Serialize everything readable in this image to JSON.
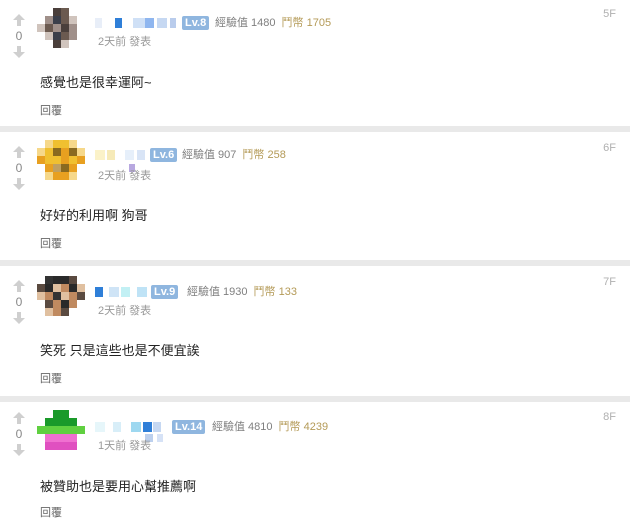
{
  "comments": [
    {
      "floor": "5F",
      "vote_count": "0",
      "level": "Lv.8",
      "exp_label": "經驗值 1480",
      "coin_label": "鬥幣 1705",
      "time": "2天前 發表",
      "text": "感覺也是很幸運阿~",
      "reply": "回覆",
      "avatar_colors": [
        "#6b5a50",
        "#a0908a",
        "#4a3f3b",
        "#d0c4bd",
        "#3b3f4a"
      ]
    },
    {
      "floor": "6F",
      "vote_count": "0",
      "level": "Lv.6",
      "exp_label": "經驗值 907",
      "coin_label": "鬥幣 258",
      "time": "2天前 發表",
      "text": "好好的利用啊 狗哥",
      "reply": "回覆",
      "avatar_colors": [
        "#f0c030",
        "#e8a020",
        "#8a6a20",
        "#f6d88a",
        "#c0a060"
      ]
    },
    {
      "floor": "7F",
      "vote_count": "0",
      "level": "Lv.9",
      "exp_label": "經驗值 1930",
      "coin_label": "鬥幣 133",
      "time": "2天前 發表",
      "text": "笑死 只是這些也是不便宜誒",
      "reply": "回覆",
      "avatar_colors": [
        "#2a2a2a",
        "#c08a60",
        "#5a4a40",
        "#e0c0a0",
        "#333333"
      ]
    },
    {
      "floor": "8F",
      "vote_count": "0",
      "level": "Lv.14",
      "exp_label": "經驗值 4810",
      "coin_label": "鬥幣 4239",
      "time": "1天前 發表",
      "text": "被贊助也是要用心幫推薦啊",
      "reply": "回覆",
      "avatar_colors": [
        "#1a9a2a",
        "#60d040",
        "#f070d0",
        "#ffffff",
        "#e050c0"
      ]
    }
  ]
}
